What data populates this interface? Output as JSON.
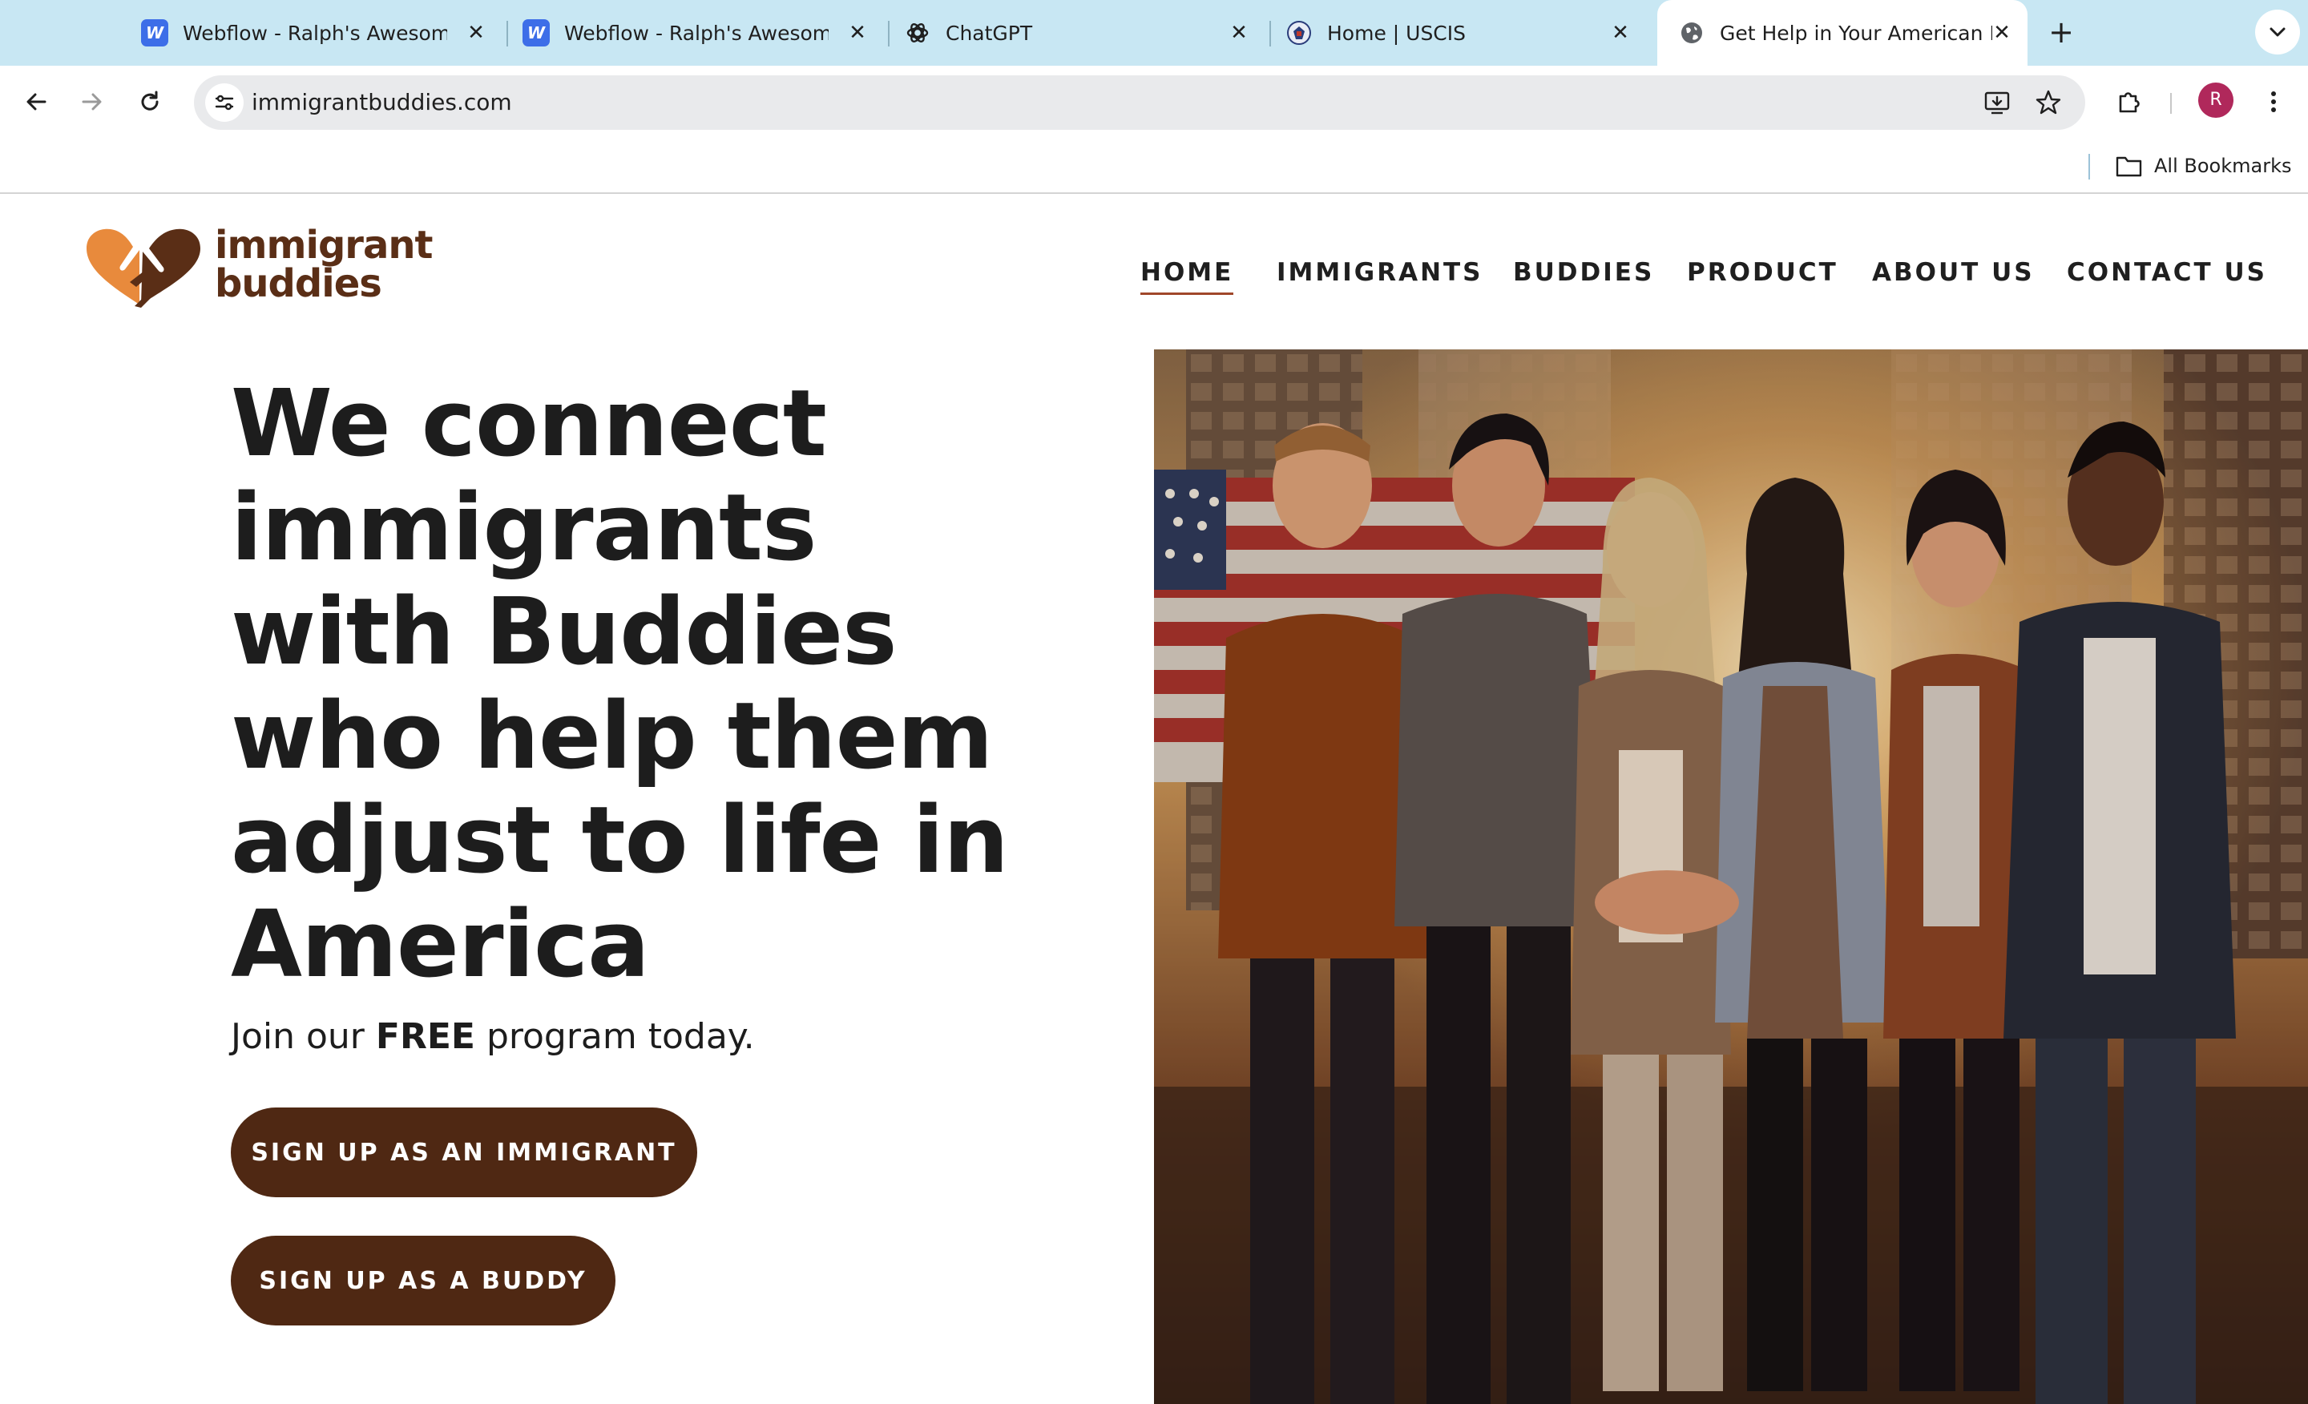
{
  "browser": {
    "tabs": [
      {
        "title": "Webflow - Ralph's Awesome Site",
        "favicon": "webflow-icon",
        "active": false
      },
      {
        "title": "Webflow - Ralph's Awesome Site",
        "favicon": "webflow-icon",
        "active": false
      },
      {
        "title": "ChatGPT",
        "favicon": "chatgpt-icon",
        "active": false
      },
      {
        "title": "Home | USCIS",
        "favicon": "uscis-seal-icon",
        "active": false
      },
      {
        "title": "Get Help in Your American Immigration",
        "favicon": "globe-icon",
        "active": true
      }
    ],
    "close_glyph": "✕",
    "new_tab_glyph": "+",
    "url": "immigrantbuddies.com",
    "profile_initial": "R",
    "bookmarks_label": "All Bookmarks"
  },
  "site": {
    "logo": {
      "line1": "immigrant",
      "line2": "buddies"
    },
    "nav": [
      {
        "label": "HOME",
        "active": true
      },
      {
        "label": "IMMIGRANTS",
        "active": false
      },
      {
        "label": "BUDDIES",
        "active": false
      },
      {
        "label": "PRODUCT",
        "active": false
      },
      {
        "label": "ABOUT US",
        "active": false
      },
      {
        "label": "CONTACT US",
        "active": false
      }
    ],
    "hero": {
      "headline_lines": [
        "We connect",
        "immigrants",
        "with Buddies",
        "who help them",
        "adjust to life in",
        "America"
      ],
      "tagline_pre": "Join our ",
      "tagline_bold": "FREE",
      "tagline_post": " program today.",
      "cta_immigrant": "SIGN UP AS AN IMMIGRANT",
      "cta_buddy": "SIGN UP AS A BUDDY"
    }
  },
  "colors": {
    "tabstrip": "#c8e7f3",
    "brand_brown": "#4f2813",
    "logo_orange": "#e88a3c",
    "logo_brown": "#5a2e16",
    "nav_underline": "#a0472a"
  }
}
